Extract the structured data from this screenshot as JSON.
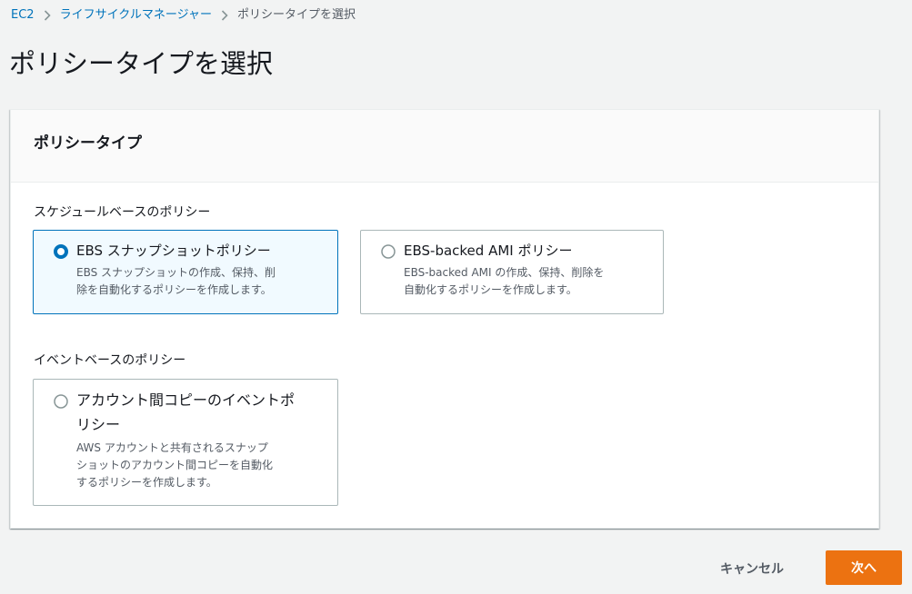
{
  "breadcrumb": {
    "items": [
      "EC2",
      "ライフサイクルマネージャー",
      "ポリシータイプを選択"
    ]
  },
  "page": {
    "title": "ポリシータイプを選択"
  },
  "panel": {
    "title": "ポリシータイプ",
    "groups": [
      {
        "label": "スケジュールベースのポリシー",
        "options": [
          {
            "title": "EBS スナップショットポリシー",
            "desc_lines": [
              "EBS スナップショットの作成、保持、削",
              "除を自動化するポリシーを作成します。"
            ],
            "selected": true
          },
          {
            "title": "EBS-backed AMI ポリシー",
            "desc_lines": [
              "EBS-backed AMI の作成、保持、削除を",
              "自動化するポリシーを作成します。"
            ],
            "selected": false
          }
        ]
      },
      {
        "label": "イベントベースのポリシー",
        "options": [
          {
            "title_lines": [
              "アカウント間コピーのイベントポ",
              "リシー"
            ],
            "desc_lines": [
              "AWS アカウントと共有されるスナップ",
              "ショットのアカウント間コピーを自動化",
              "するポリシーを作成します。"
            ],
            "selected": false
          }
        ]
      }
    ]
  },
  "actions": {
    "cancel_label": "キャンセル",
    "next_label": "次へ"
  },
  "colors": {
    "link": "#0073bb",
    "selected_border": "#0073bb",
    "selected_bg": "#f1faff",
    "primary_button": "#ec7211",
    "background": "#f2f3f3"
  },
  "icons": {
    "separator": "chevron-right-icon",
    "radio_on": "radio-selected-icon",
    "radio_off": "radio-unselected-icon"
  }
}
